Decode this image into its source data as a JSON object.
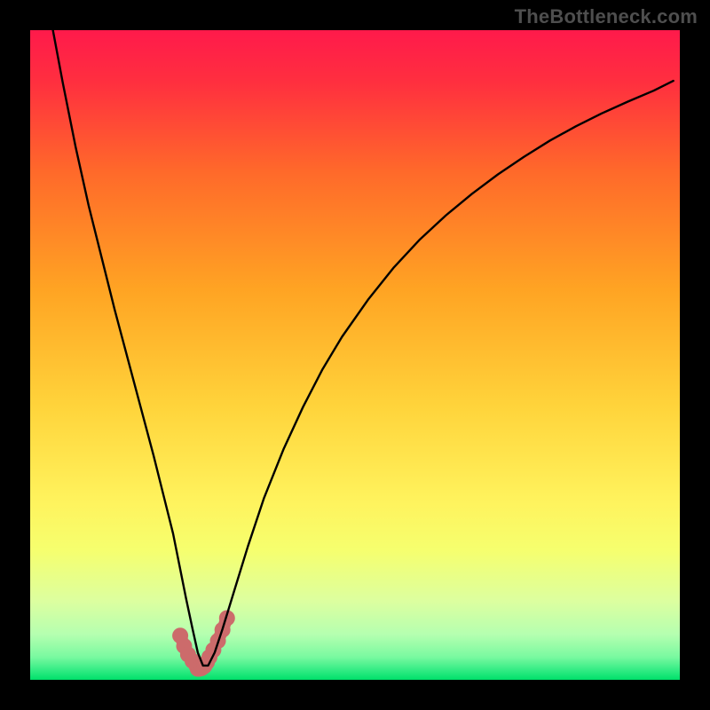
{
  "watermark": "TheBottleneck.com",
  "chart_data": {
    "type": "line",
    "title": "",
    "xlabel": "",
    "ylabel": "",
    "xlim": [
      0,
      100
    ],
    "ylim": [
      0,
      100
    ],
    "grid": false,
    "legend": false,
    "background_gradient": {
      "top": "#ff1a4b",
      "upper_mid": "#ff7a2a",
      "mid": "#ffd43b",
      "lower_mid": "#f6ff6e",
      "lower": "#c9ffb0",
      "bottom": "#00e06a"
    },
    "curve": {
      "name": "bottleneck-valley",
      "color": "#000000",
      "x": [
        3.5,
        5,
        7,
        9,
        11,
        13,
        15,
        17,
        19,
        20.5,
        22,
        23,
        24,
        25,
        25.8,
        26.6,
        27.4,
        28.4,
        29.6,
        31.5,
        33.5,
        36,
        39,
        42,
        45,
        48,
        52,
        56,
        60,
        64,
        68,
        72,
        76,
        80,
        84,
        88,
        92,
        96,
        99
      ],
      "y": [
        100,
        92,
        82,
        73,
        65,
        57,
        49.5,
        42,
        34.5,
        28.5,
        22.5,
        17.5,
        12.5,
        7.8,
        4.2,
        2.2,
        2.2,
        4.2,
        7.8,
        14,
        20.5,
        28,
        35.5,
        42,
        47.8,
        52.8,
        58.5,
        63.5,
        67.8,
        71.5,
        74.8,
        77.8,
        80.5,
        83,
        85.2,
        87.2,
        89,
        90.7,
        92.2
      ]
    },
    "marker_band": {
      "name": "optimal-band",
      "color": "#cc6b6b",
      "x": [
        23.1,
        23.7,
        24.3,
        25.0,
        25.6,
        25.8,
        26.0,
        26.4,
        26.8,
        27.2,
        27.6,
        28.2,
        28.9,
        29.6,
        30.3
      ],
      "y": [
        6.8,
        5.2,
        3.9,
        2.9,
        2.2,
        1.7,
        1.7,
        1.8,
        2.1,
        2.7,
        3.5,
        4.6,
        6.0,
        7.7,
        9.5
      ]
    }
  }
}
